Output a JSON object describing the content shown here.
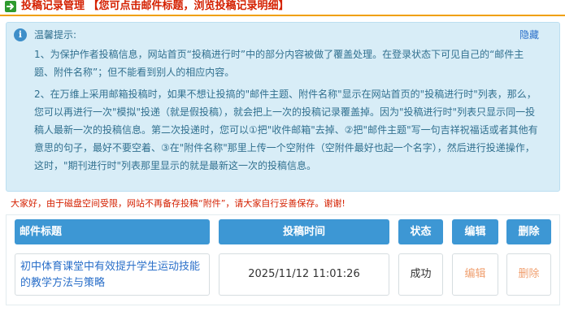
{
  "header": {
    "title": "投稿记录管理 【您可点击邮件标题，浏览投稿记录明细】"
  },
  "tip": {
    "title": "温馨提示:",
    "hide_label": "隐藏",
    "para1": "1、为保护作者投稿信息，网站首页“投稿进行时”中的部分内容被做了覆盖处理。在登录状态下可见自己的“邮件主题、附件名称”；但不能看到别人的相应内容。",
    "para2": "2、在万维上采用邮箱投稿时，如果不想让投搞的\"邮件主题、附件名称\"显示在网站首页的\"投稿进行时\"列表，那么，您可以再进行一次\"模拟\"投递（就是假投稿），就会把上一次的投稿记录覆盖掉。因为\"投稿进行时\"列表只显示同一投稿人最新一次的投稿信息。第二次投递时，您可以①把\"收件邮箱\"去掉、②把\"邮件主题\"写一句吉祥祝福话或者其他有意思的句子，最好不要空着、③在\"附件名称\"那里上传一个空附件（空附件最好也起一个名字），然后进行投递操作，这时，\"期刊进行时\"列表那里显示的就是最新这一次的投稿信息。"
  },
  "notice": "大家好，由于磁盘空间受限，网站不再备存投稿“附件”，请大家自行妥善保存。谢谢!",
  "table": {
    "headers": {
      "subject": "邮件标题",
      "time": "投稿时间",
      "status": "状态",
      "edit": "编辑",
      "delete": "删除"
    },
    "rows": [
      {
        "subject": "初中体育课堂中有效提升学生运动技能的教学方法与策略",
        "time": "2025/11/12 11:01:26",
        "status": "成功",
        "edit": "编辑",
        "delete": "删除"
      }
    ]
  },
  "colors": {
    "header_title": "#d42000",
    "header_rule": "#f0a000",
    "tip_bg": "#d8edf7",
    "tip_text": "#31708f",
    "table_header_bg": "#3d97d4",
    "link": "#2a6fc9",
    "action_text": "#f0a070"
  },
  "icons": {
    "header": "arrow-right-icon",
    "tip": "info-icon"
  }
}
